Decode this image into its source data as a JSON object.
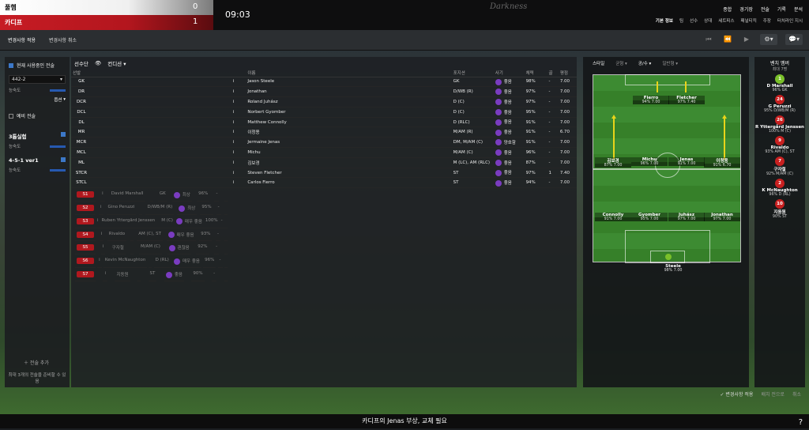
{
  "match": {
    "home_team": "풀햄",
    "home_score": "0",
    "away_team": "카디프",
    "away_score": "1",
    "clock": "09:03",
    "brand": "Darkness"
  },
  "nav": {
    "main": [
      "종합",
      "경기장",
      "전술",
      "기록",
      "분석"
    ],
    "sub": [
      "기본 정보",
      "팀",
      "선수",
      "상대",
      "세트피스",
      "패널티킥",
      "주장",
      "터치라인 지시"
    ]
  },
  "toolbar": {
    "apply": "변경사항 적용",
    "cancel": "변경사항 취소"
  },
  "left": {
    "current_tactic": "현재 사용중인 전술",
    "formation": "442-2",
    "fluency": "능숙도",
    "options": "옵션",
    "reserve": "예비 전술",
    "tactic1": "3톱실험",
    "tactic2": "4-5-1 ver1",
    "add": "전술 추가",
    "note": "최대 3개의 전술을 준비할 수 있음"
  },
  "table": {
    "tab_label": "선수단",
    "view_label": "컨디션",
    "headers": [
      "선발",
      "이름",
      "포지션",
      "사기",
      "체력",
      "골",
      "평점"
    ],
    "rows": [
      {
        "pos": "GK",
        "name": "Jason Steele",
        "role": "GK",
        "morale": "좋음",
        "cond": "98%",
        "goals": "-",
        "rating": "7.00"
      },
      {
        "pos": "DR",
        "name": "Jonathan",
        "role": "D/WB (R)",
        "morale": "좋음",
        "cond": "97%",
        "goals": "-",
        "rating": "7.00"
      },
      {
        "pos": "DCR",
        "name": "Roland Juhász",
        "role": "D (C)",
        "morale": "좋음",
        "cond": "97%",
        "goals": "-",
        "rating": "7.00"
      },
      {
        "pos": "DCL",
        "name": "Norbert Gyomber",
        "role": "D (C)",
        "morale": "좋음",
        "cond": "95%",
        "goals": "-",
        "rating": "7.00"
      },
      {
        "pos": "DL",
        "name": "Matthew Connolly",
        "role": "D (RLC)",
        "morale": "좋음",
        "cond": "91%",
        "goals": "-",
        "rating": "7.00"
      },
      {
        "pos": "MR",
        "name": "이청용",
        "role": "M/AM (R)",
        "morale": "좋음",
        "cond": "91%",
        "goals": "-",
        "rating": "6.70"
      },
      {
        "pos": "MCR",
        "name": "Jermaine Jenas",
        "role": "DM, M/AM (C)",
        "morale": "양호함",
        "cond": "91%",
        "goals": "-",
        "rating": "7.00"
      },
      {
        "pos": "MCL",
        "name": "Michu",
        "role": "M/AM (C)",
        "morale": "좋음",
        "cond": "96%",
        "goals": "-",
        "rating": "7.00"
      },
      {
        "pos": "ML",
        "name": "김보경",
        "role": "M (LC), AM (RLC)",
        "morale": "좋음",
        "cond": "87%",
        "goals": "-",
        "rating": "7.00"
      },
      {
        "pos": "STCR",
        "name": "Steven Fletcher",
        "role": "ST",
        "morale": "좋음",
        "cond": "97%",
        "goals": "1",
        "rating": "7.40"
      },
      {
        "pos": "STCL",
        "name": "Carlos Fierro",
        "role": "ST",
        "morale": "좋음",
        "cond": "94%",
        "goals": "-",
        "rating": "7.00"
      }
    ],
    "subs": [
      {
        "pos": "S1",
        "name": "David Marshall",
        "role": "GK",
        "morale": "최상",
        "cond": "96%",
        "goals": "-"
      },
      {
        "pos": "S2",
        "name": "Gino Peruzzi",
        "role": "D/WB/M (R)",
        "morale": "최상",
        "cond": "95%",
        "goals": "-"
      },
      {
        "pos": "S3",
        "name": "Ruben Yttergård Jenssen",
        "role": "M (C)",
        "morale": "매우 좋음",
        "cond": "100%",
        "goals": "-"
      },
      {
        "pos": "S4",
        "name": "Rivaldo",
        "role": "AM (C), ST",
        "morale": "매우 좋음",
        "cond": "93%",
        "goals": "-"
      },
      {
        "pos": "S5",
        "name": "구자철",
        "role": "M/AM (C)",
        "morale": "괜찮음",
        "cond": "92%",
        "goals": "-"
      },
      {
        "pos": "S6",
        "name": "Kevin McNaughton",
        "role": "D (RL)",
        "morale": "매우 좋음",
        "cond": "96%",
        "goals": "-"
      },
      {
        "pos": "S7",
        "name": "지동원",
        "role": "ST",
        "morale": "좋음",
        "cond": "90%",
        "goals": "-"
      }
    ]
  },
  "pitch": {
    "head": [
      "스타일",
      "균형",
      "공/수",
      "일반형"
    ],
    "players": {
      "fierro": {
        "name": "Fierro",
        "stat": "94% 7.00"
      },
      "fletcher": {
        "name": "Fletcher",
        "stat": "97% 7.40"
      },
      "kim": {
        "name": "김보경",
        "stat": "87% 7.00"
      },
      "michu": {
        "name": "Michu",
        "stat": "96% 7.00"
      },
      "jenas": {
        "name": "Jenas",
        "stat": "91% 7.00"
      },
      "lee": {
        "name": "이청용",
        "stat": "91% 6.70"
      },
      "connolly": {
        "name": "Connolly",
        "stat": "91% 7.00"
      },
      "gyomber": {
        "name": "Gyomber",
        "stat": "95% 7.00"
      },
      "juhasz": {
        "name": "Juhász",
        "stat": "97% 7.00"
      },
      "jonathan": {
        "name": "Jonathan",
        "stat": "97% 7.00"
      },
      "steele": {
        "name": "Steele",
        "stat": "98% 7.00"
      }
    }
  },
  "bench": {
    "title": "벤치 멤버",
    "subtitle": "최대 7명",
    "players": [
      {
        "num": "1",
        "name": "D Marshall",
        "stat": "96% GK",
        "gk": true
      },
      {
        "num": "24",
        "name": "G Peruzzi",
        "stat": "95% D/WB/M (R)"
      },
      {
        "num": "26",
        "name": "R Yttergård Jenssen",
        "stat": "100% M (C)"
      },
      {
        "num": "9",
        "name": "Rivaldo",
        "stat": "93% AM (C), ST"
      },
      {
        "num": "7",
        "name": "구자철",
        "stat": "92% M/AM (C)"
      },
      {
        "num": "2",
        "name": "K McNaughton",
        "stat": "96% D (RL)"
      },
      {
        "num": "10",
        "name": "지동원",
        "stat": "90% ST"
      }
    ]
  },
  "bottom": {
    "apply": "변경사항 적용",
    "reset": "배치 전으로",
    "cancel": "취소"
  },
  "footer": {
    "message": "카디프의 Jenas 부상, 교체 필요",
    "help": "?"
  }
}
